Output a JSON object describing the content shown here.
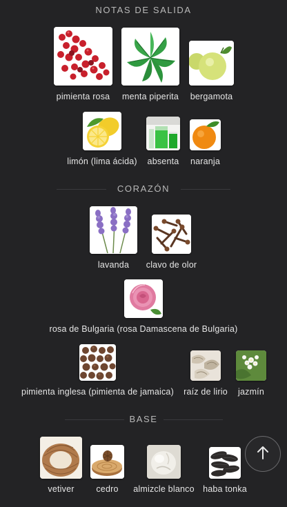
{
  "sections": {
    "top": {
      "title": "NOTAS DE SALIDA"
    },
    "heart": {
      "title": "CORAZÓN"
    },
    "base": {
      "title": "BASE"
    }
  },
  "notes": {
    "pimienta_rosa": {
      "label": "pimienta rosa",
      "icon": "pink-pepper-image"
    },
    "menta_piperita": {
      "label": "menta piperita",
      "icon": "peppermint-image"
    },
    "bergamota": {
      "label": "bergamota",
      "icon": "bergamot-image"
    },
    "limon": {
      "label": "limón (lima ácida)",
      "icon": "lemon-image"
    },
    "absenta": {
      "label": "absenta",
      "icon": "absinthe-image"
    },
    "naranja": {
      "label": "naranja",
      "icon": "orange-image"
    },
    "lavanda": {
      "label": "lavanda",
      "icon": "lavender-image"
    },
    "clavo": {
      "label": "clavo de olor",
      "icon": "clove-image"
    },
    "rosa_bulgaria": {
      "label": "rosa de Bulgaria (rosa Damascena de Bulgaria)",
      "icon": "rose-image"
    },
    "pimienta_inglesa": {
      "label": "pimienta inglesa (pimienta de jamaica)",
      "icon": "allspice-image"
    },
    "raiz_lirio": {
      "label": "raíz de lirio",
      "icon": "orris-root-image"
    },
    "jazmin": {
      "label": "jazmín",
      "icon": "jasmine-image"
    },
    "vetiver": {
      "label": "vetiver",
      "icon": "vetiver-image"
    },
    "cedro": {
      "label": "cedro",
      "icon": "cedar-image"
    },
    "almizcle": {
      "label": "almizcle blanco",
      "icon": "white-musk-image"
    },
    "haba_tonka": {
      "label": "haba tonka",
      "icon": "tonka-bean-image"
    }
  },
  "scroll_top": {
    "icon": "arrow-up-icon"
  }
}
